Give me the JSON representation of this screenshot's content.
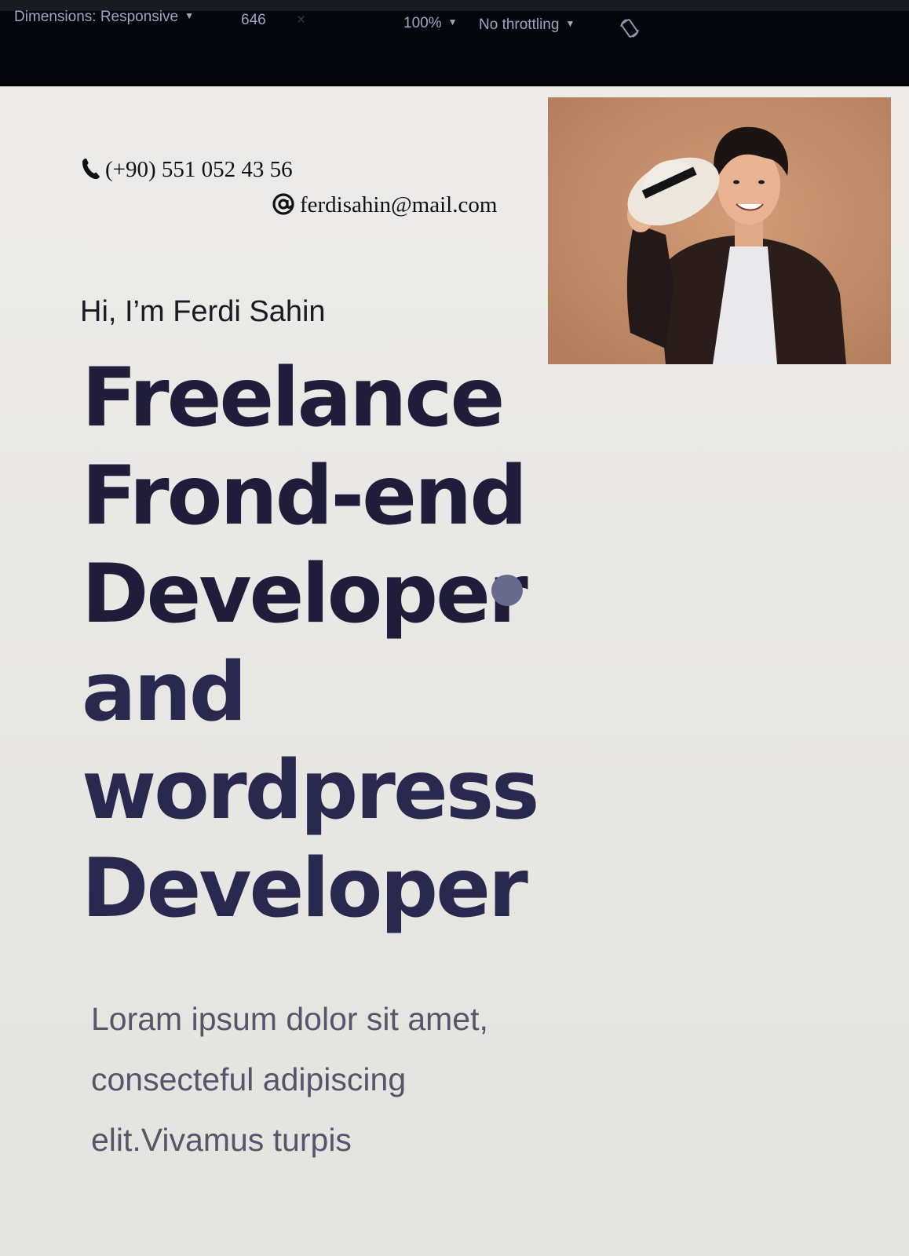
{
  "devtools": {
    "dimensions_label": "Dimensions: Responsive",
    "width_value": "646",
    "times_symbol": "×",
    "zoom_label": "100%",
    "throttling_label": "No throttling",
    "caret": "▼",
    "rotate_icon": "rotate-icon"
  },
  "contact": {
    "phone": "(+90) 551 052 43 56",
    "phone_icon": "phone-icon",
    "email": "ferdisahin@mail.com",
    "email_icon": "at-icon"
  },
  "hero": {
    "greeting": "Hi, I’m Ferdi Sahin",
    "headline_lines": [
      "Freelance",
      "Frond-end",
      "Developer",
      "and",
      "wordpress",
      "Developer"
    ],
    "intro": "Loram ipsum dolor sit amet, consecteful adipiscing elit.Vivamus turpis"
  },
  "portrait": {
    "image_name": "profile-photo"
  },
  "colors": {
    "toolbar_bg": "#05060d",
    "page_bg": "#e8e8e4",
    "headline": "#1f1d3a",
    "intro_text": "#55566a",
    "portrait_bg": "#c4906d"
  }
}
